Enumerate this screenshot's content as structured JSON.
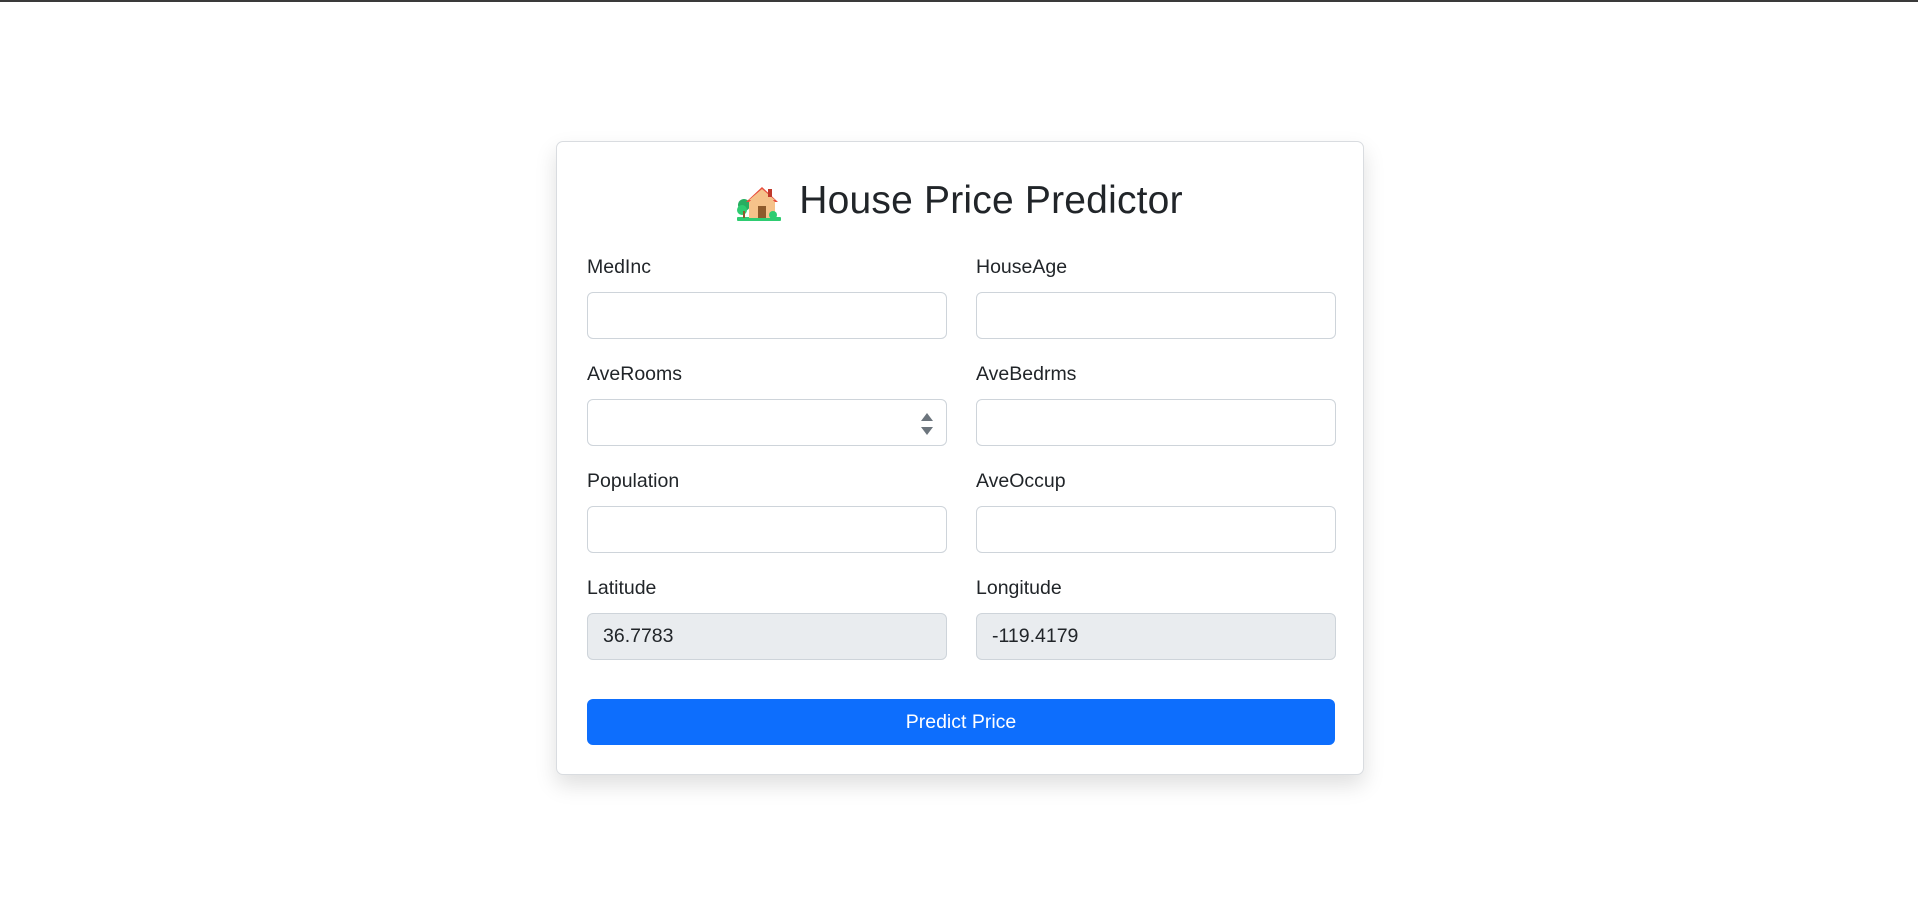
{
  "app": {
    "title": "House Price Predictor",
    "title_icon": "house-with-garden-icon"
  },
  "form": {
    "fields": [
      {
        "label": "MedInc",
        "value": "",
        "placeholder": ""
      },
      {
        "label": "HouseAge",
        "value": "",
        "placeholder": ""
      },
      {
        "label": "AveRooms",
        "value": "",
        "placeholder": "",
        "control": "number-spinner"
      },
      {
        "label": "AveBedrms",
        "value": "",
        "placeholder": ""
      },
      {
        "label": "Population",
        "value": "",
        "placeholder": ""
      },
      {
        "label": "AveOccup",
        "value": "",
        "placeholder": ""
      },
      {
        "label": "Latitude",
        "value": "36.7783",
        "readonly": true
      },
      {
        "label": "Longitude",
        "value": "-119.4179",
        "readonly": true
      }
    ],
    "submit_label": "Predict Price"
  },
  "colors": {
    "primary": "#0d6efd",
    "readonly_bg": "#e9ecef",
    "border": "#ced4da",
    "text": "#212529"
  }
}
